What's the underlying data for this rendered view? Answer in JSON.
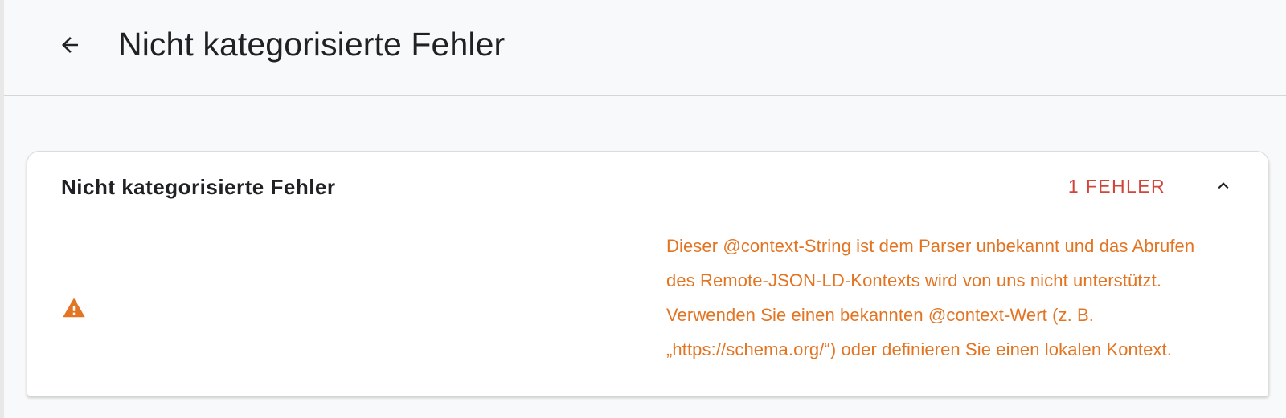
{
  "header": {
    "back_icon": "arrow-back-icon",
    "title": "Nicht kategorisierte Fehler"
  },
  "card": {
    "title": "Nicht kategorisierte Fehler",
    "error_count": "1 FEHLER",
    "toggle_icon": "chevron-up-icon",
    "issue": {
      "icon": "warning-icon",
      "message": "Dieser @context-String ist dem Parser unbekannt und das Abrufen des Remote-JSON-LD-Kontexts wird von uns nicht unterstützt. Verwenden Sie einen bekannten @context-Wert (z. B. „https://schema.org/“) oder definieren Sie einen lokalen Kontext."
    }
  },
  "colors": {
    "error_red": "#d0463b",
    "warning_orange": "#e37422",
    "text": "#202124",
    "background": "#f8f9fa"
  }
}
